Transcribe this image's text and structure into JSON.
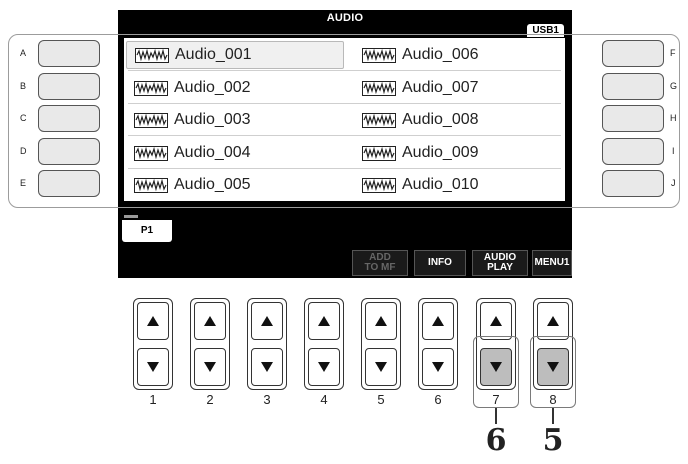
{
  "screen": {
    "title": "AUDIO",
    "device_tab": "USB1",
    "files": [
      {
        "name": "Audio_001",
        "selected": true
      },
      {
        "name": "Audio_002",
        "selected": false
      },
      {
        "name": "Audio_003",
        "selected": false
      },
      {
        "name": "Audio_004",
        "selected": false
      },
      {
        "name": "Audio_005",
        "selected": false
      },
      {
        "name": "Audio_006",
        "selected": false
      },
      {
        "name": "Audio_007",
        "selected": false
      },
      {
        "name": "Audio_008",
        "selected": false
      },
      {
        "name": "Audio_009",
        "selected": false
      },
      {
        "name": "Audio_010",
        "selected": false
      }
    ],
    "page_tab": "P1",
    "soft_buttons": {
      "add_to_mf": "ADD TO MF",
      "info": "INFO",
      "audio_play": "AUDIO PLAY",
      "menu1": "MENU1"
    }
  },
  "side_buttons": {
    "left": [
      "A",
      "B",
      "C",
      "D",
      "E"
    ],
    "right": [
      "F",
      "G",
      "H",
      "I",
      "J"
    ]
  },
  "knob_numbers": [
    "1",
    "2",
    "3",
    "4",
    "5",
    "6",
    "7",
    "8"
  ],
  "callouts": {
    "step_a": "6",
    "step_b": "5"
  },
  "icons": {
    "file": "audio-waveform-icon",
    "up": "triangle-up-icon",
    "down": "triangle-down-icon"
  }
}
